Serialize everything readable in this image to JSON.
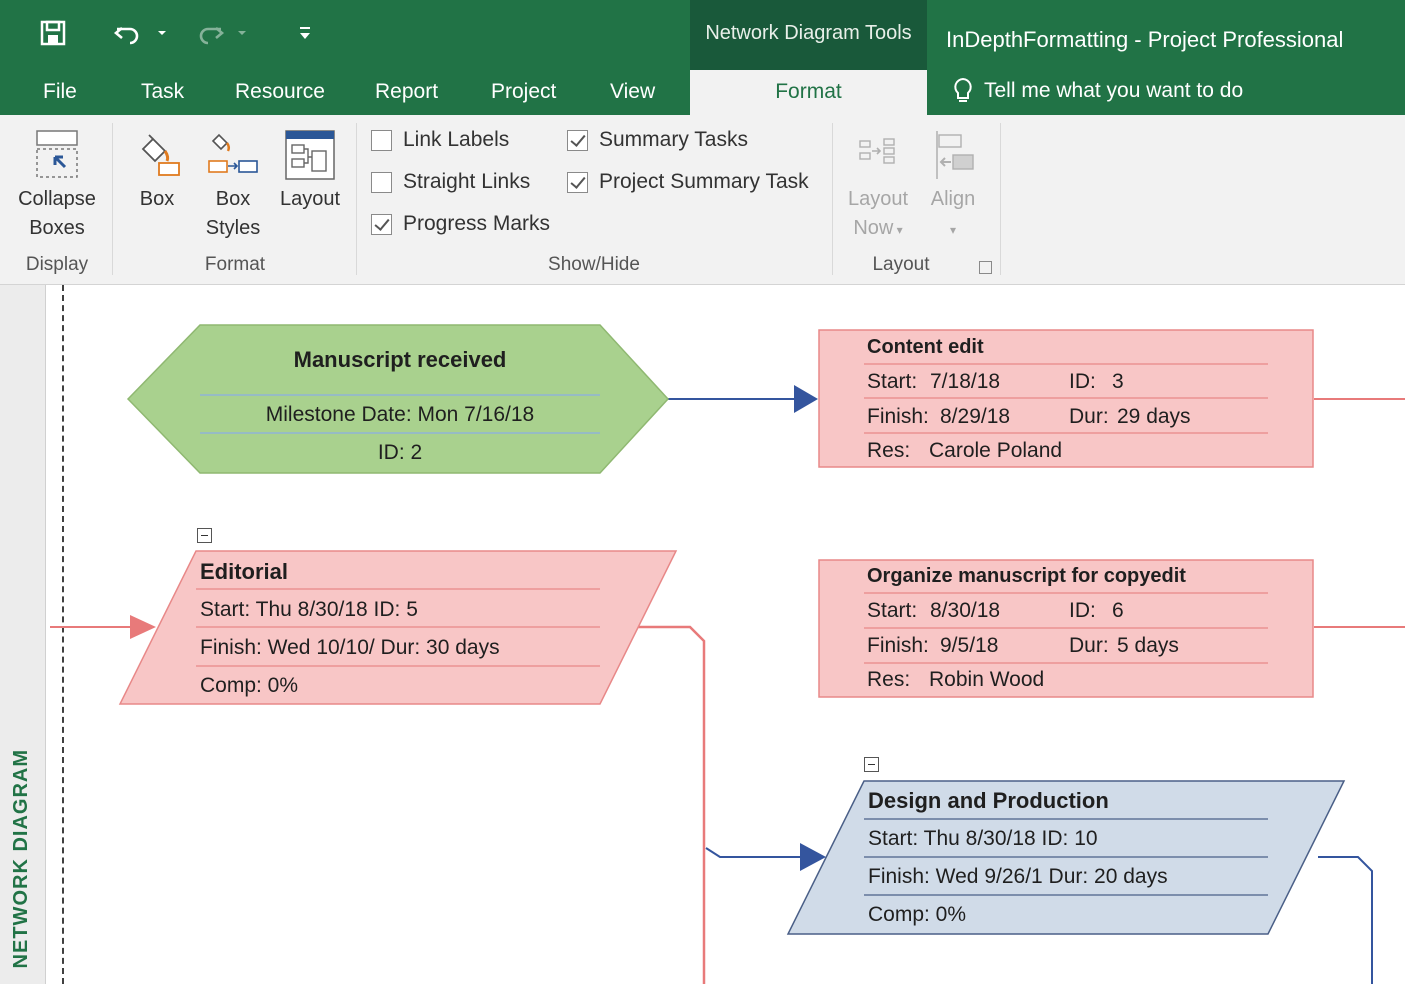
{
  "titlebar": {
    "context_label": "Network Diagram Tools",
    "app_title": "InDepthFormatting - Project Professional"
  },
  "tabs": [
    {
      "label": "File"
    },
    {
      "label": "Task"
    },
    {
      "label": "Resource"
    },
    {
      "label": "Report"
    },
    {
      "label": "Project"
    },
    {
      "label": "View"
    },
    {
      "label": "Format",
      "active": true
    }
  ],
  "tellme": {
    "placeholder": "Tell me what you want to do"
  },
  "ribbon": {
    "display": {
      "collapse_boxes_line1": "Collapse",
      "collapse_boxes_line2": "Boxes",
      "group_label": "Display"
    },
    "format": {
      "box_label": "Box",
      "box_styles_line1": "Box",
      "box_styles_line2": "Styles",
      "layout_label": "Layout",
      "group_label": "Format"
    },
    "show_hide": {
      "link_labels": {
        "label": "Link Labels",
        "checked": false
      },
      "straight_links": {
        "label": "Straight Links",
        "checked": false
      },
      "progress_marks": {
        "label": "Progress Marks",
        "checked": true
      },
      "summary_tasks": {
        "label": "Summary Tasks",
        "checked": true
      },
      "project_summary_task": {
        "label": "Project Summary Task",
        "checked": true
      },
      "group_label": "Show/Hide"
    },
    "layout": {
      "layout_now_line1": "Layout",
      "layout_now_line2": "Now",
      "align_label": "Align",
      "group_label": "Layout"
    }
  },
  "view": {
    "side_label": "NETWORK DIAGRAM"
  },
  "nodes": {
    "manuscript_received": {
      "title": "Manuscript received",
      "milestone_date": "Milestone Date: Mon 7/16/18",
      "id_text": "ID: 2",
      "fill": "#a9d18e",
      "border": "#8fb871"
    },
    "content_edit": {
      "title": "Content edit",
      "start_label": "Start:",
      "start_value": "7/18/18",
      "id_label": "ID:",
      "id_value": "3",
      "finish_label": "Finish:",
      "finish_value": "8/29/18",
      "dur_label": "Dur:",
      "dur_value": "29 days",
      "res_label": "Res:",
      "res_value": "Carole Poland",
      "fill": "#f8c6c6",
      "border": "#e88888"
    },
    "editorial": {
      "title": "Editorial",
      "start_line": "Start:  Thu 8/30/18 ID:   5",
      "finish_line": "Finish: Wed 10/10/ Dur: 30 days",
      "comp_line": "Comp: 0%",
      "fill": "#f8c6c6",
      "border": "#e88888"
    },
    "organize_manuscript": {
      "title": "Organize manuscript for copyedit",
      "start_label": "Start:",
      "start_value": "8/30/18",
      "id_label": "ID:",
      "id_value": "6",
      "finish_label": "Finish:",
      "finish_value": "9/5/18",
      "dur_label": "Dur:",
      "dur_value": "5 days",
      "res_label": "Res:",
      "res_value": "Robin Wood",
      "fill": "#f8c6c6",
      "border": "#e88888"
    },
    "design_production": {
      "title": "Design and Production",
      "start_line": "Start:  Thu 8/30/18 ID:   10",
      "finish_line": "Finish: Wed 9/26/1 Dur: 20 days",
      "comp_line": "Comp: 0%",
      "fill": "#d0dbe8",
      "border": "#4a5f87"
    }
  },
  "colors": {
    "ribbon_green": "#217346",
    "context_green": "#19593a",
    "critical_link": "#e87a7a",
    "normal_link": "#34559e"
  }
}
